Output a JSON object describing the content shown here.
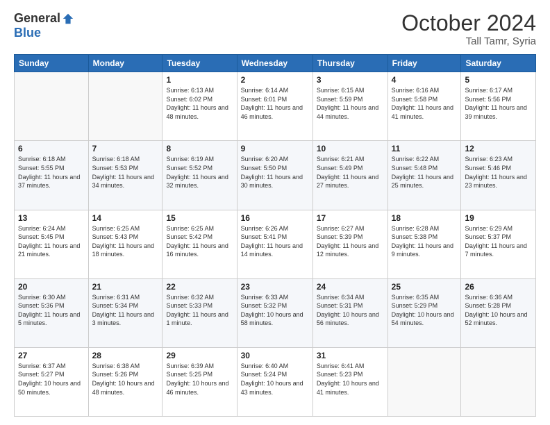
{
  "header": {
    "logo_general": "General",
    "logo_blue": "Blue",
    "month_title": "October 2024",
    "location": "Tall Tamr, Syria"
  },
  "weekdays": [
    "Sunday",
    "Monday",
    "Tuesday",
    "Wednesday",
    "Thursday",
    "Friday",
    "Saturday"
  ],
  "weeks": [
    [
      {
        "day": "",
        "info": ""
      },
      {
        "day": "",
        "info": ""
      },
      {
        "day": "1",
        "info": "Sunrise: 6:13 AM\nSunset: 6:02 PM\nDaylight: 11 hours and 48 minutes."
      },
      {
        "day": "2",
        "info": "Sunrise: 6:14 AM\nSunset: 6:01 PM\nDaylight: 11 hours and 46 minutes."
      },
      {
        "day": "3",
        "info": "Sunrise: 6:15 AM\nSunset: 5:59 PM\nDaylight: 11 hours and 44 minutes."
      },
      {
        "day": "4",
        "info": "Sunrise: 6:16 AM\nSunset: 5:58 PM\nDaylight: 11 hours and 41 minutes."
      },
      {
        "day": "5",
        "info": "Sunrise: 6:17 AM\nSunset: 5:56 PM\nDaylight: 11 hours and 39 minutes."
      }
    ],
    [
      {
        "day": "6",
        "info": "Sunrise: 6:18 AM\nSunset: 5:55 PM\nDaylight: 11 hours and 37 minutes."
      },
      {
        "day": "7",
        "info": "Sunrise: 6:18 AM\nSunset: 5:53 PM\nDaylight: 11 hours and 34 minutes."
      },
      {
        "day": "8",
        "info": "Sunrise: 6:19 AM\nSunset: 5:52 PM\nDaylight: 11 hours and 32 minutes."
      },
      {
        "day": "9",
        "info": "Sunrise: 6:20 AM\nSunset: 5:50 PM\nDaylight: 11 hours and 30 minutes."
      },
      {
        "day": "10",
        "info": "Sunrise: 6:21 AM\nSunset: 5:49 PM\nDaylight: 11 hours and 27 minutes."
      },
      {
        "day": "11",
        "info": "Sunrise: 6:22 AM\nSunset: 5:48 PM\nDaylight: 11 hours and 25 minutes."
      },
      {
        "day": "12",
        "info": "Sunrise: 6:23 AM\nSunset: 5:46 PM\nDaylight: 11 hours and 23 minutes."
      }
    ],
    [
      {
        "day": "13",
        "info": "Sunrise: 6:24 AM\nSunset: 5:45 PM\nDaylight: 11 hours and 21 minutes."
      },
      {
        "day": "14",
        "info": "Sunrise: 6:25 AM\nSunset: 5:43 PM\nDaylight: 11 hours and 18 minutes."
      },
      {
        "day": "15",
        "info": "Sunrise: 6:25 AM\nSunset: 5:42 PM\nDaylight: 11 hours and 16 minutes."
      },
      {
        "day": "16",
        "info": "Sunrise: 6:26 AM\nSunset: 5:41 PM\nDaylight: 11 hours and 14 minutes."
      },
      {
        "day": "17",
        "info": "Sunrise: 6:27 AM\nSunset: 5:39 PM\nDaylight: 11 hours and 12 minutes."
      },
      {
        "day": "18",
        "info": "Sunrise: 6:28 AM\nSunset: 5:38 PM\nDaylight: 11 hours and 9 minutes."
      },
      {
        "day": "19",
        "info": "Sunrise: 6:29 AM\nSunset: 5:37 PM\nDaylight: 11 hours and 7 minutes."
      }
    ],
    [
      {
        "day": "20",
        "info": "Sunrise: 6:30 AM\nSunset: 5:36 PM\nDaylight: 11 hours and 5 minutes."
      },
      {
        "day": "21",
        "info": "Sunrise: 6:31 AM\nSunset: 5:34 PM\nDaylight: 11 hours and 3 minutes."
      },
      {
        "day": "22",
        "info": "Sunrise: 6:32 AM\nSunset: 5:33 PM\nDaylight: 11 hours and 1 minute."
      },
      {
        "day": "23",
        "info": "Sunrise: 6:33 AM\nSunset: 5:32 PM\nDaylight: 10 hours and 58 minutes."
      },
      {
        "day": "24",
        "info": "Sunrise: 6:34 AM\nSunset: 5:31 PM\nDaylight: 10 hours and 56 minutes."
      },
      {
        "day": "25",
        "info": "Sunrise: 6:35 AM\nSunset: 5:29 PM\nDaylight: 10 hours and 54 minutes."
      },
      {
        "day": "26",
        "info": "Sunrise: 6:36 AM\nSunset: 5:28 PM\nDaylight: 10 hours and 52 minutes."
      }
    ],
    [
      {
        "day": "27",
        "info": "Sunrise: 6:37 AM\nSunset: 5:27 PM\nDaylight: 10 hours and 50 minutes."
      },
      {
        "day": "28",
        "info": "Sunrise: 6:38 AM\nSunset: 5:26 PM\nDaylight: 10 hours and 48 minutes."
      },
      {
        "day": "29",
        "info": "Sunrise: 6:39 AM\nSunset: 5:25 PM\nDaylight: 10 hours and 46 minutes."
      },
      {
        "day": "30",
        "info": "Sunrise: 6:40 AM\nSunset: 5:24 PM\nDaylight: 10 hours and 43 minutes."
      },
      {
        "day": "31",
        "info": "Sunrise: 6:41 AM\nSunset: 5:23 PM\nDaylight: 10 hours and 41 minutes."
      },
      {
        "day": "",
        "info": ""
      },
      {
        "day": "",
        "info": ""
      }
    ]
  ]
}
